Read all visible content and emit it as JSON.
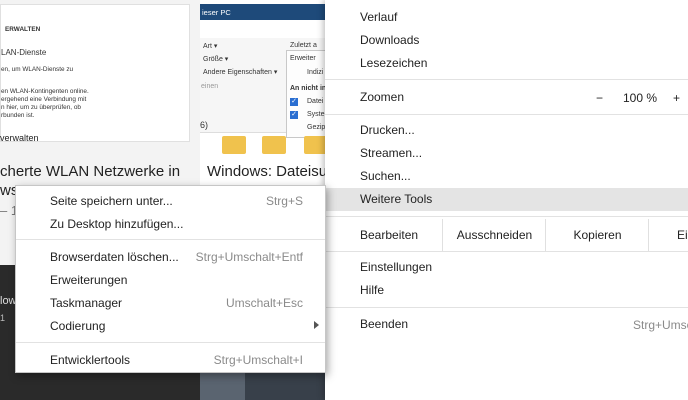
{
  "background": {
    "left_card": {
      "header_label": "ERWALTEN",
      "line1": "LAN-Dienste",
      "line2": "en, um WLAN-Dienste zu",
      "line3": "en WLAN-Kontingenten online.",
      "line4": "ergehend eine Verbindung mit",
      "line5": "n hier, um zu überprüfen, ob",
      "line6": "rbunden ist.",
      "link": "verwalten",
      "title_line1": "cherte WLAN Netzwerke in",
      "title_line2": "ws",
      "meta": "– 1"
    },
    "mid_card": {
      "bar_title": "ieser PC",
      "art": "Art ▾",
      "groesse": "Größe ▾",
      "andere": "Andere Eigenschaften ▾",
      "einen": "einen",
      "zuletzt": "Zuletzt a",
      "erweitert": "Erweiter",
      "indizi": "Indizi",
      "an_nicht": "An nicht in",
      "datei": "Datei",
      "syste": "Syste",
      "gezip": "Gezip",
      "count": "6)",
      "title": "Windows: Dateisuc"
    },
    "photo_left": {
      "text1": "low",
      "text2": "1"
    }
  },
  "menu": {
    "items_top": [
      "Verlauf",
      "Downloads",
      "Lesezeichen"
    ],
    "zoom": {
      "label": "Zoomen",
      "minus": "−",
      "value": "100 %",
      "plus": "+"
    },
    "items_mid": [
      "Drucken...",
      "Streamen...",
      "Suchen...",
      "Weitere Tools"
    ],
    "edit": {
      "label": "Bearbeiten",
      "cut": "Ausschneiden",
      "copy": "Kopieren",
      "paste": "Ei"
    },
    "items_settings": [
      "Einstellungen",
      "Hilfe"
    ],
    "exit": {
      "label": "Beenden",
      "shortcut": "Strg+Umsc"
    }
  },
  "submenu": {
    "group1": [
      {
        "label": "Seite speichern unter...",
        "shortcut": "Strg+S"
      },
      {
        "label": "Zu Desktop hinzufügen...",
        "shortcut": ""
      }
    ],
    "group2": [
      {
        "label": "Browserdaten löschen...",
        "shortcut": "Strg+Umschalt+Entf"
      },
      {
        "label": "Erweiterungen",
        "shortcut": ""
      },
      {
        "label": "Taskmanager",
        "shortcut": "Umschalt+Esc"
      },
      {
        "label": "Codierung",
        "shortcut": ""
      }
    ],
    "group3": [
      {
        "label": "Entwicklertools",
        "shortcut": "Strg+Umschalt+I"
      }
    ]
  },
  "colors": {
    "highlight": "#e4e4e4",
    "accent_blue": "#2a6ed1",
    "window_bar": "#1e4a7a"
  }
}
